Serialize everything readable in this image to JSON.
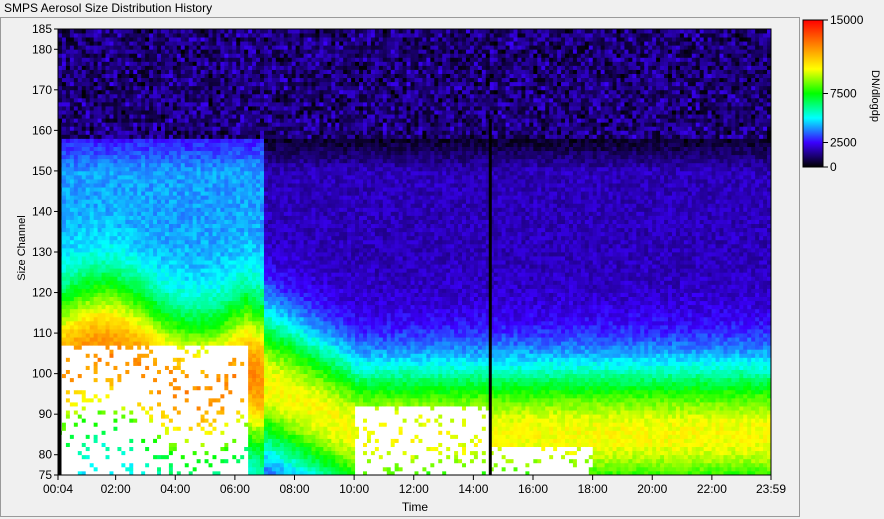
{
  "window": {
    "title": "SMPS Aerosol Size Distribution History"
  },
  "chart_data": {
    "type": "heatmap",
    "title": "",
    "xlabel": "Time",
    "ylabel": "Size Channel",
    "x_range": [
      "00:04",
      "23:59"
    ],
    "y_range": [
      75,
      185
    ],
    "x_tick_labels": [
      "00:04",
      "02:00",
      "04:00",
      "06:00",
      "08:00",
      "10:00",
      "12:00",
      "14:00",
      "16:00",
      "18:00",
      "20:00",
      "22:00",
      "23:59"
    ],
    "y_ticks": [
      75,
      80,
      90,
      100,
      110,
      120,
      130,
      140,
      150,
      160,
      170,
      180,
      185
    ],
    "colorbar": {
      "label": "DN/dlogdp",
      "ticks": [
        0,
        2500,
        7500,
        15000
      ],
      "tick_labels": [
        "0",
        "2500",
        "7500",
        "15000"
      ],
      "colors": [
        "#000000",
        "#3b00ff",
        "#00ffff",
        "#00ff00",
        "#ffff00",
        "#ff8000",
        "#ff0000"
      ]
    },
    "vertical_markers": [
      "00:04",
      "14:30"
    ],
    "features": [
      {
        "desc": "saturated (>15000) peak region",
        "time_range": [
          "00:04",
          "06:30"
        ],
        "size_range": [
          75,
          110
        ]
      },
      {
        "desc": "saturated region",
        "time_range": [
          "10:00",
          "14:30"
        ],
        "size_range": [
          75,
          95
        ]
      },
      {
        "desc": "saturated region",
        "time_range": [
          "14:30",
          "18:00"
        ],
        "size_range": [
          75,
          85
        ]
      },
      {
        "desc": "low counts (<500) above",
        "size_range": [
          160,
          185
        ]
      }
    ]
  }
}
